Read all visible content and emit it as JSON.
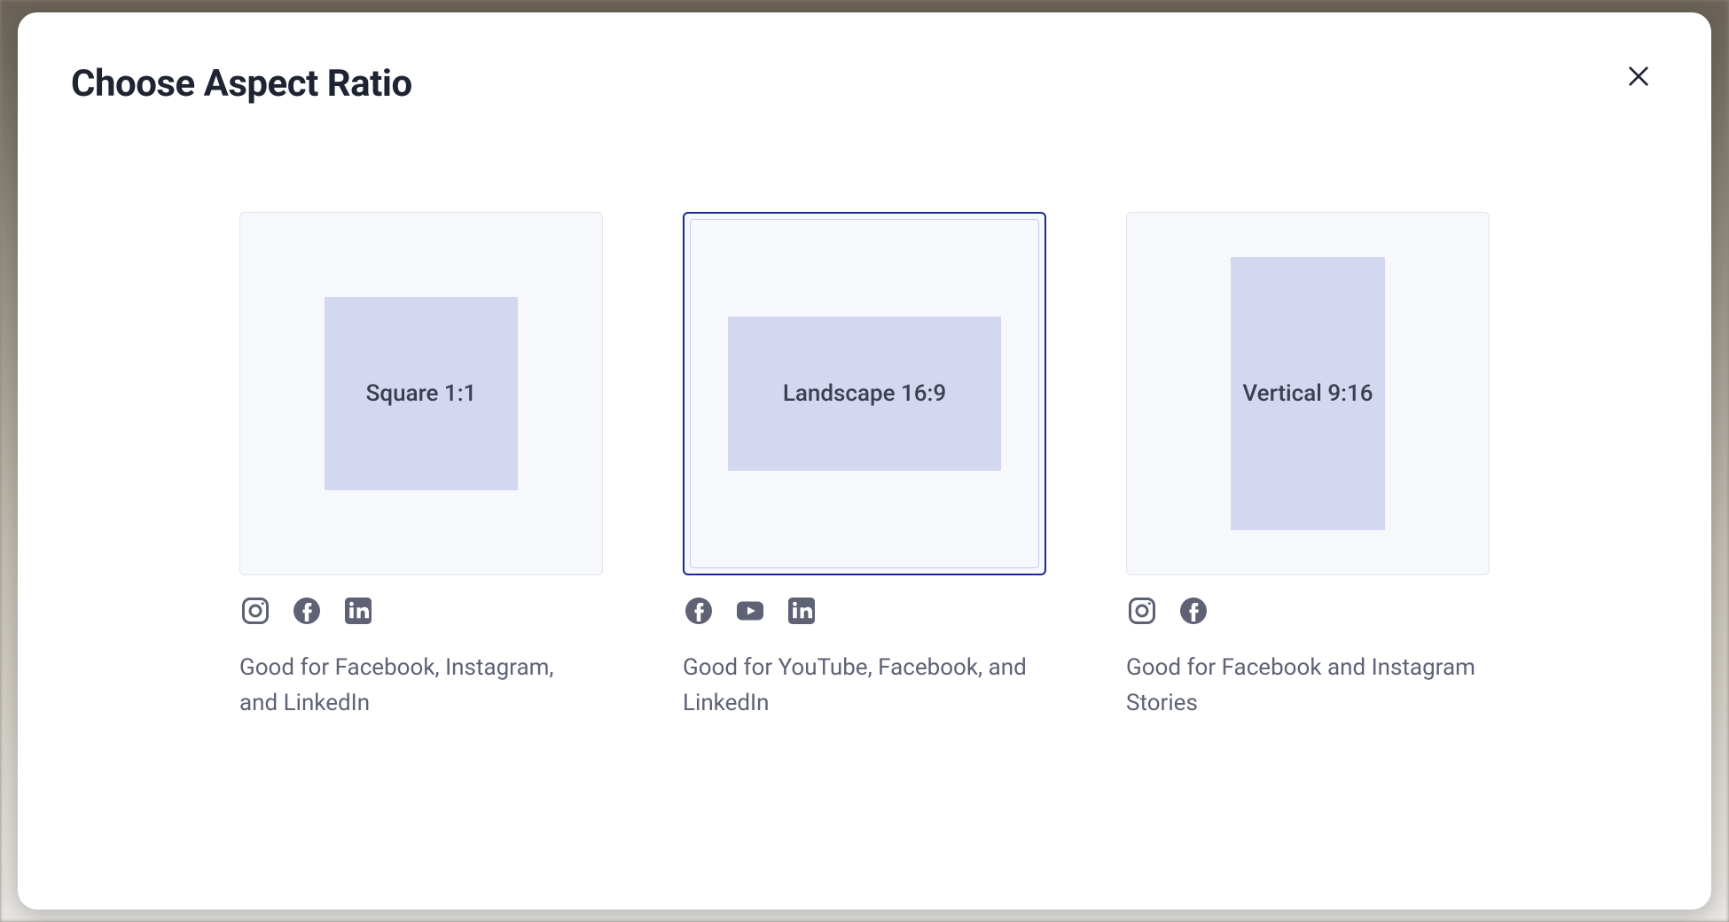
{
  "modal": {
    "title": "Choose Aspect Ratio"
  },
  "options": [
    {
      "shape_label": "Square 1:1",
      "description": "Good for Facebook, Instagram, and LinkedIn",
      "icons": [
        "instagram",
        "facebook",
        "linkedin"
      ],
      "selected": false,
      "shape": "square"
    },
    {
      "shape_label": "Landscape 16:9",
      "description": "Good for YouTube, Facebook, and LinkedIn",
      "icons": [
        "facebook",
        "youtube",
        "linkedin"
      ],
      "selected": true,
      "shape": "landscape"
    },
    {
      "shape_label": "Vertical 9:16",
      "description": "Good for Facebook and Instagram Stories",
      "icons": [
        "instagram",
        "facebook"
      ],
      "selected": false,
      "shape": "vertical"
    }
  ]
}
